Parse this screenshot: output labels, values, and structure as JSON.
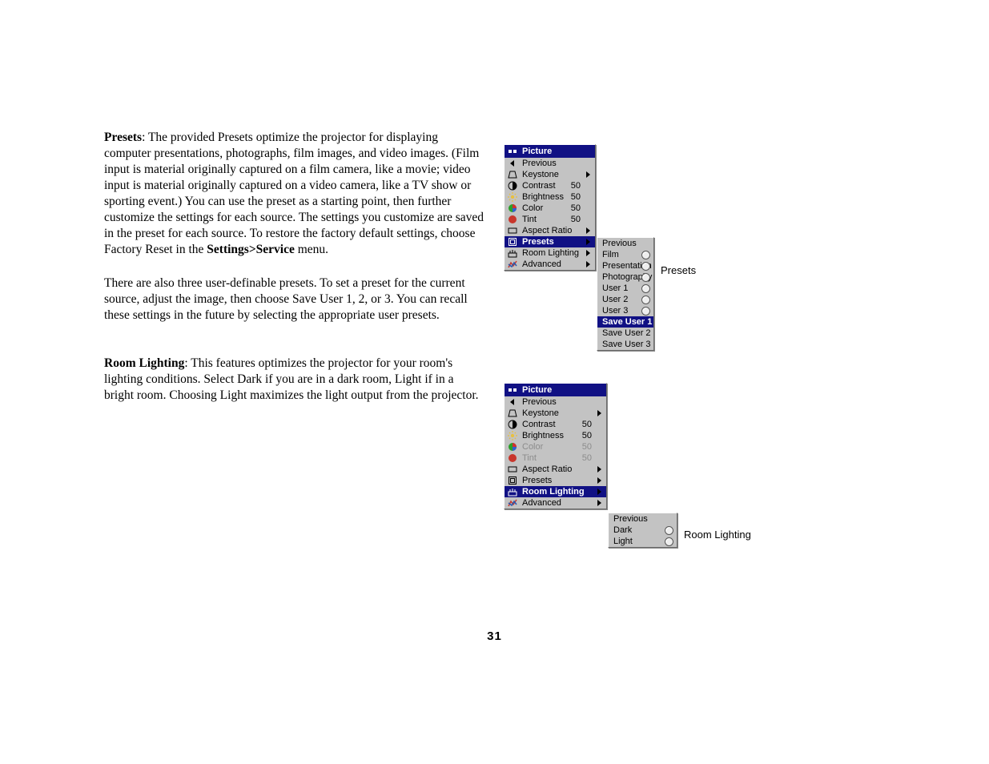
{
  "text": {
    "presets_bold": "Presets",
    "presets_body": ": The provided Presets optimize the projector for displaying computer presentations, photographs, film images, and video images. (Film input is material originally captured on a film camera, like a movie; video input is material originally captured on a video camera, like a TV show or sporting event.) You can use the preset as a starting point, then further customize the settings for each source. The settings you customize are saved in the preset for each source. To restore the factory default settings, choose Factory Reset in the ",
    "settings_service_bold": "Settings>Service",
    "presets_body_tail": " menu.",
    "user_presets": "There are also three user-definable presets. To set a preset for the current source, adjust the image, then choose Save User 1, 2, or 3. You can recall these settings in the future by selecting the appropriate user presets.",
    "room_bold": "Room Lighting",
    "room_body": ": This features optimizes the projector for your room's lighting conditions. Select Dark if you are in a dark room, Light if in a bright room. Choosing Light maximizes the light output from the projector."
  },
  "page_number": "31",
  "menu1": {
    "title": "Picture",
    "rows": [
      {
        "label": "Previous",
        "icon": "back"
      },
      {
        "label": "Keystone",
        "icon": "keystone",
        "arrow": true
      },
      {
        "label": "Contrast",
        "icon": "contrast",
        "value": "50"
      },
      {
        "label": "Brightness",
        "icon": "bright",
        "value": "50"
      },
      {
        "label": "Color",
        "icon": "color",
        "value": "50"
      },
      {
        "label": "Tint",
        "icon": "tint",
        "value": "50"
      },
      {
        "label": "Aspect Ratio",
        "icon": "aspect",
        "arrow": true
      },
      {
        "label": "Presets",
        "icon": "presets",
        "arrow": true,
        "selected": true
      },
      {
        "label": "Room Lighting",
        "icon": "room",
        "arrow": true
      },
      {
        "label": "Advanced",
        "icon": "adv",
        "arrow": true
      }
    ]
  },
  "submenu1": {
    "rows": [
      {
        "label": "Previous"
      },
      {
        "label": "Film",
        "radio": true
      },
      {
        "label": "Presentation",
        "radio": true
      },
      {
        "label": "Photography",
        "radio": true
      },
      {
        "label": "User 1",
        "radio": true
      },
      {
        "label": "User 2",
        "radio": true
      },
      {
        "label": "User 3",
        "radio": true
      },
      {
        "label": "Save User 1",
        "selected": true
      },
      {
        "label": "Save User 2"
      },
      {
        "label": "Save User 3"
      }
    ]
  },
  "caption1": "Presets",
  "menu2": {
    "title": "Picture",
    "rows": [
      {
        "label": "Previous",
        "icon": "back"
      },
      {
        "label": "Keystone",
        "icon": "keystone",
        "arrow": true
      },
      {
        "label": "Contrast",
        "icon": "contrast",
        "value": "50"
      },
      {
        "label": "Brightness",
        "icon": "bright",
        "value": "50"
      },
      {
        "label": "Color",
        "icon": "color",
        "value": "50",
        "dim": true
      },
      {
        "label": "Tint",
        "icon": "tint",
        "value": "50",
        "dim": true
      },
      {
        "label": "Aspect Ratio",
        "icon": "aspect",
        "arrow": true
      },
      {
        "label": "Presets",
        "icon": "presets",
        "arrow": true
      },
      {
        "label": "Room Lighting",
        "icon": "room",
        "arrow": true,
        "selected": true
      },
      {
        "label": "Advanced",
        "icon": "adv",
        "arrow": true
      }
    ]
  },
  "submenu2": {
    "rows": [
      {
        "label": "Previous"
      },
      {
        "label": "Dark",
        "radio": true
      },
      {
        "label": "Light",
        "radio": true
      }
    ]
  },
  "caption2": "Room Lighting"
}
